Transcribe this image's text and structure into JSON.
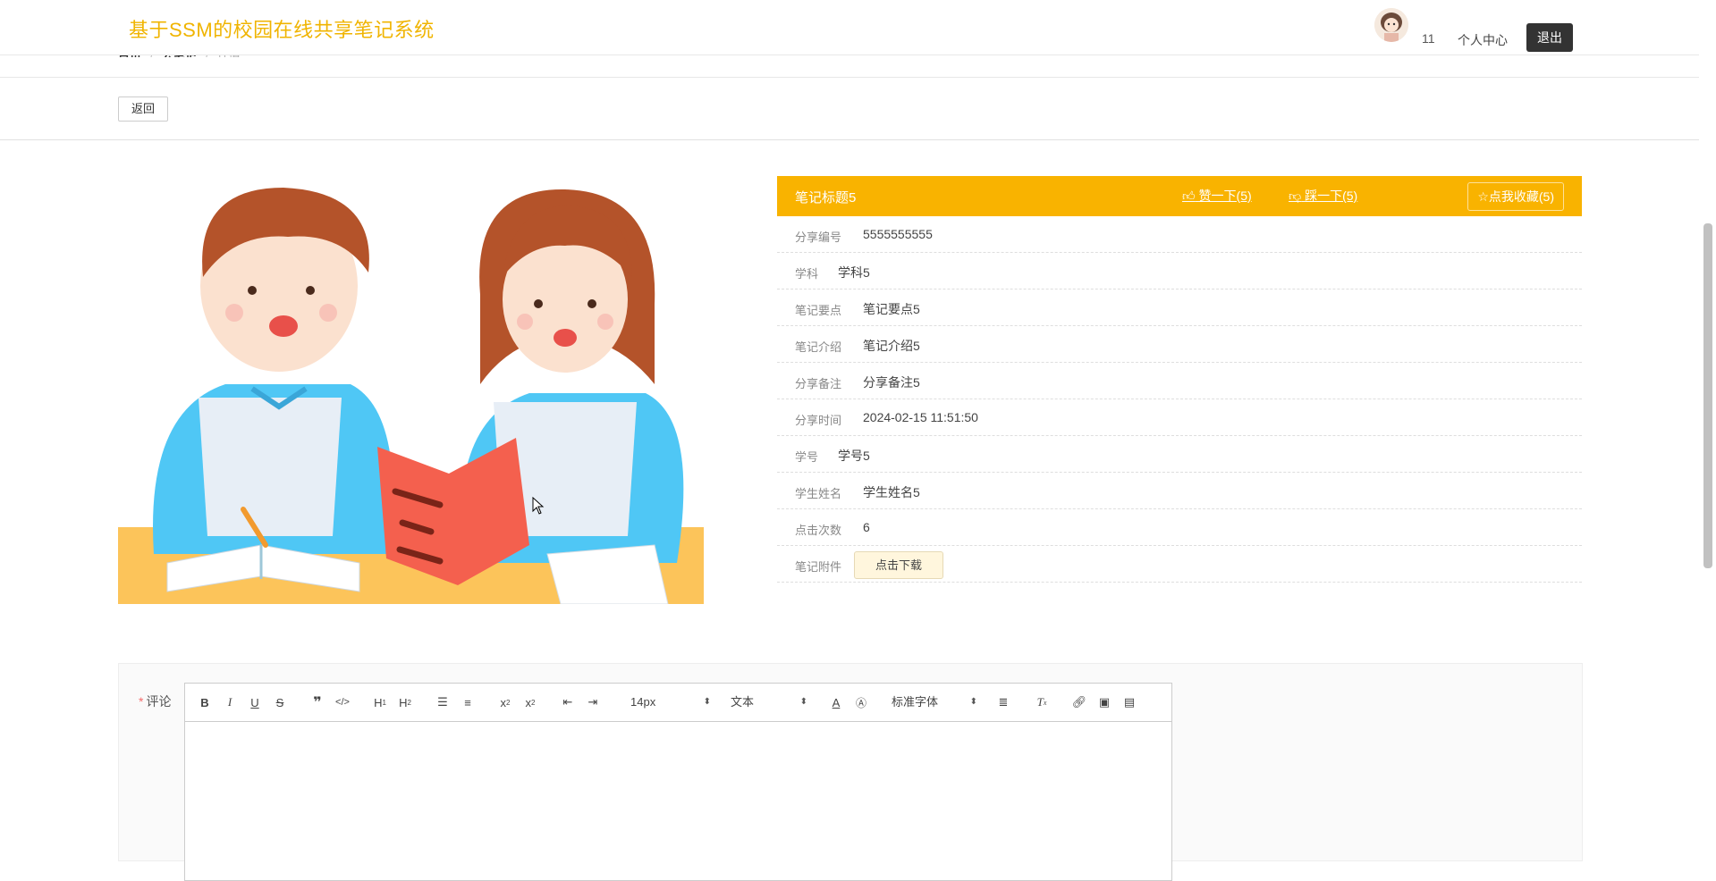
{
  "header": {
    "site_title": "基于SSM的校园在线共享笔记系统",
    "user_num": "11",
    "user_center": "个人中心",
    "logout": "退出"
  },
  "breadcrumb": [
    "首页",
    "云笔记",
    "详情"
  ],
  "back_label": "返回",
  "detail": {
    "title": "笔记标题5",
    "like": "赞一下(5)",
    "dislike": "踩一下(5)",
    "favorite": "点我收藏(5)",
    "fields": [
      {
        "label": "分享编号",
        "value": "5555555555"
      },
      {
        "label": "学科",
        "value": "学科5"
      },
      {
        "label": "笔记要点",
        "value": "笔记要点5"
      },
      {
        "label": "笔记介绍",
        "value": "笔记介绍5"
      },
      {
        "label": "分享备注",
        "value": "分享备注5"
      },
      {
        "label": "分享时间",
        "value": "2024-02-15 11:51:50"
      },
      {
        "label": "学号",
        "value": "学号5"
      },
      {
        "label": "学生姓名",
        "value": "学生姓名5"
      },
      {
        "label": "点击次数",
        "value": "6"
      }
    ],
    "attachment_label": "笔记附件",
    "download": "点击下载"
  },
  "comment": {
    "label": "评论",
    "toolbar": {
      "size": "14px",
      "header": "文本",
      "font": "标准字体"
    }
  },
  "colors": {
    "accent": "#f9b300",
    "title": "#f0b400"
  }
}
